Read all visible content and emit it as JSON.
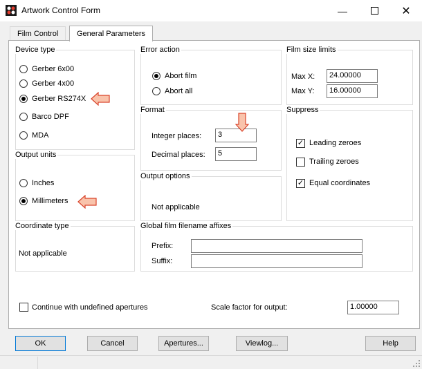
{
  "window": {
    "title": "Artwork Control Form"
  },
  "tabs": [
    {
      "label": "Film Control"
    },
    {
      "label": "General Parameters"
    }
  ],
  "device_type": {
    "label": "Device type",
    "options": [
      "Gerber 6x00",
      "Gerber 4x00",
      "Gerber RS274X",
      "Barco DPF",
      "MDA"
    ],
    "selected": "Gerber RS274X"
  },
  "error_action": {
    "label": "Error action",
    "options": [
      "Abort film",
      "Abort all"
    ],
    "selected": "Abort film"
  },
  "film_size": {
    "label": "Film size limits",
    "max_x_label": "Max X:",
    "max_x": "24.00000",
    "max_y_label": "Max Y:",
    "max_y": "16.00000"
  },
  "format": {
    "label": "Format",
    "integer_label": "Integer places:",
    "integer_value": "3",
    "decimal_label": "Decimal places:",
    "decimal_value": "5"
  },
  "suppress": {
    "label": "Suppress",
    "leading": "Leading zeroes",
    "trailing": "Trailing zeroes",
    "equal": "Equal coordinates"
  },
  "output_units": {
    "label": "Output units",
    "options": [
      "Inches",
      "Millimeters"
    ],
    "selected": "Millimeters"
  },
  "output_options": {
    "label": "Output options",
    "value": "Not applicable"
  },
  "coordinate_type": {
    "label": "Coordinate type",
    "value": "Not applicable"
  },
  "global_affixes": {
    "label": "Global film filename affixes",
    "prefix_label": "Prefix:",
    "prefix": "",
    "suffix_label": "Suffix:",
    "suffix": ""
  },
  "continue_label": "Continue with undefined apertures",
  "scale": {
    "label": "Scale factor for output:",
    "value": "1.00000"
  },
  "buttons": {
    "ok": "OK",
    "cancel": "Cancel",
    "apertures": "Apertures...",
    "viewlog": "Viewlog...",
    "help": "Help"
  },
  "colors": {
    "arrow_fill": "#f9c3ab",
    "arrow_stroke": "#d9432a"
  }
}
